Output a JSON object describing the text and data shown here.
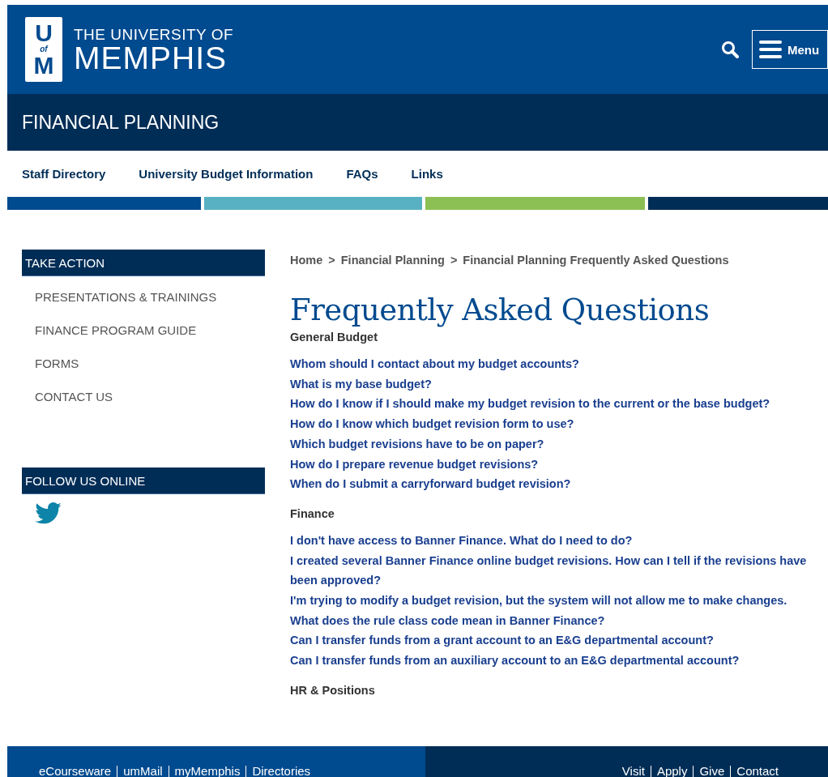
{
  "header": {
    "logo_letters": [
      "U",
      "of",
      "M"
    ],
    "university_line": "THE UNIVERSITY OF",
    "university_name": "MEMPHIS",
    "menu_button": "Menu"
  },
  "site_title": "FINANCIAL PLANNING",
  "nav": [
    "Staff Directory",
    "University Budget Information",
    "FAQs",
    "Links"
  ],
  "color_bars": [
    {
      "color": "#004a8f"
    },
    {
      "color": "#58b1c3"
    },
    {
      "color": "#8dc054"
    },
    {
      "color": "#002d56"
    }
  ],
  "sidebar": {
    "take_action": {
      "title": "TAKE ACTION",
      "items": [
        "PRESENTATIONS & TRAININGS",
        "FINANCE PROGRAM GUIDE",
        "FORMS",
        "CONTACT US"
      ]
    },
    "follow": {
      "title": "FOLLOW US ONLINE"
    }
  },
  "breadcrumbs": [
    "Home",
    "Financial Planning",
    "Financial Planning Frequently Asked Questions"
  ],
  "breadcrumb_separators": [
    ">",
    ">"
  ],
  "page_title": "Frequently Asked Questions",
  "sections": [
    {
      "heading": "General Budget",
      "questions": [
        "Whom should I contact about my budget accounts?",
        "What is my base budget?",
        "How do I know if I should make my budget revision to the current or the base budget?",
        "How do I know which budget revision form to use?",
        "Which budget revisions have to be on paper?",
        "How do I prepare revenue budget revisions?",
        "When do I submit a carryforward budget revision?"
      ]
    },
    {
      "heading": "Finance",
      "questions": [
        "I don't have access to Banner Finance. What do I need to do?",
        "I created several Banner Finance online budget revisions. How can I tell if the revisions have been approved?",
        "I'm trying to modify a budget revision, but the system will not allow me to make changes.",
        "What does the rule class code mean in Banner Finance?",
        "Can I transfer funds from a grant account to an E&G departmental account?",
        "Can I transfer funds from an auxiliary account to an E&G departmental account?"
      ]
    },
    {
      "heading": "HR & Positions"
    }
  ],
  "footer": {
    "left_links": [
      "eCourseware",
      "umMail",
      "myMemphis",
      "Directories"
    ],
    "right_links": [
      "Visit",
      "Apply",
      "Give",
      "Contact"
    ]
  }
}
